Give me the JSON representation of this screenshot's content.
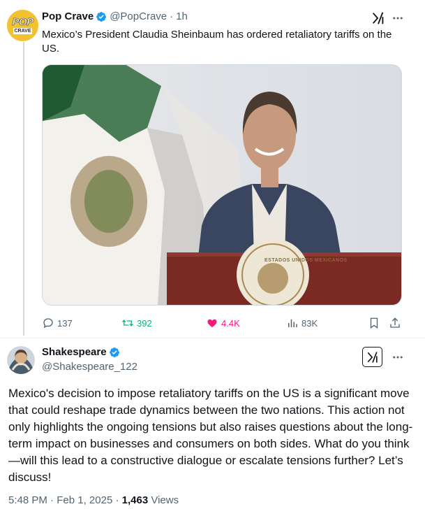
{
  "tweet1": {
    "author_name": "Pop Crave",
    "handle": "@PopCrave",
    "separator": "·",
    "time": "1h",
    "avatar_text": "POP",
    "avatar_subtext": "CRAVE",
    "text": "Mexico’s President Claudia Sheinbaum has ordered retaliatory tariffs on the US.",
    "image_icon": "photo-podium-flag",
    "seal_text": "ESTADOS UNIDOS MEXICANOS",
    "actions": {
      "replies": "137",
      "reposts": "392",
      "likes": "4.4K",
      "views": "83K"
    },
    "colors": {
      "repost": "#00ba7c",
      "like": "#f91880",
      "verified": "#1d9bf0"
    }
  },
  "tweet2": {
    "author_name": "Shakespeare",
    "handle": "@Shakespeare_122",
    "text": "Mexico's decision to impose retaliatory tariffs on the US is a significant move that could reshape trade dynamics between the two nations. This action not only highlights the ongoing tensions but also raises questions about the long-term impact on businesses and consumers on both sides. What do you think—will this lead to a constructive dialogue or escalate tensions further? Let’s discuss!",
    "time": "5:48 PM",
    "date": "Feb 1, 2025",
    "dot": "·",
    "views_count": "1,463",
    "views_label": "Views"
  }
}
